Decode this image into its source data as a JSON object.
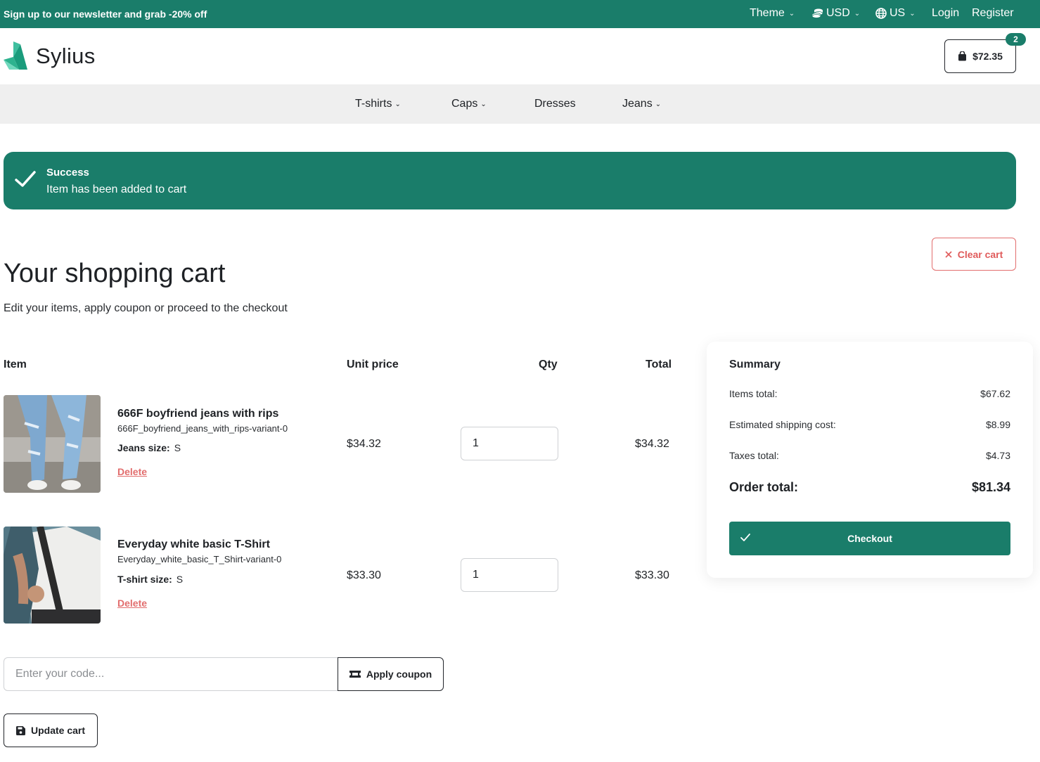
{
  "topbar": {
    "promo": "Sign up to our newsletter and grab -20% off",
    "theme": "Theme",
    "currency": "USD",
    "locale": "US",
    "login": "Login",
    "register": "Register"
  },
  "header": {
    "brand": "Sylius",
    "cart_total": "$72.35",
    "cart_count": "2"
  },
  "nav": {
    "items": [
      {
        "label": "T-shirts",
        "icon": "chevron-down-icon"
      },
      {
        "label": "Caps",
        "icon": "chevron-down-icon"
      },
      {
        "label": "Dresses"
      },
      {
        "label": "Jeans",
        "icon": "chevron-down-icon"
      }
    ]
  },
  "alert": {
    "title": "Success",
    "message": "Item has been added to cart"
  },
  "page": {
    "title": "Your shopping cart",
    "subtitle": "Edit your items, apply coupon or proceed to the checkout",
    "clear_cart": "Clear cart"
  },
  "table": {
    "headers": {
      "item": "Item",
      "unit_price": "Unit price",
      "qty": "Qty",
      "total": "Total"
    },
    "rows": [
      {
        "name": "666F boyfriend jeans with rips",
        "code": "666F_boyfriend_jeans_with_rips-variant-0",
        "option_label": "Jeans size:",
        "option_value": "S",
        "delete": "Delete",
        "unit_price": "$34.32",
        "qty": "1",
        "total": "$34.32"
      },
      {
        "name": "Everyday white basic T-Shirt",
        "code": "Everyday_white_basic_T_Shirt-variant-0",
        "option_label": "T-shirt size:",
        "option_value": "S",
        "delete": "Delete",
        "unit_price": "$33.30",
        "qty": "1",
        "total": "$33.30"
      }
    ]
  },
  "summary": {
    "title": "Summary",
    "items_total_label": "Items total:",
    "items_total": "$67.62",
    "shipping_label": "Estimated shipping cost:",
    "shipping": "$8.99",
    "taxes_label": "Taxes total:",
    "taxes": "$4.73",
    "order_total_label": "Order total:",
    "order_total": "$81.34",
    "checkout": "Checkout"
  },
  "coupon": {
    "placeholder": "Enter your code...",
    "apply": "Apply coupon"
  },
  "update_cart": "Update cart",
  "colors": {
    "brand": "#1a7d6a",
    "danger": "#e26d6d",
    "nav_bg": "#efefef"
  }
}
